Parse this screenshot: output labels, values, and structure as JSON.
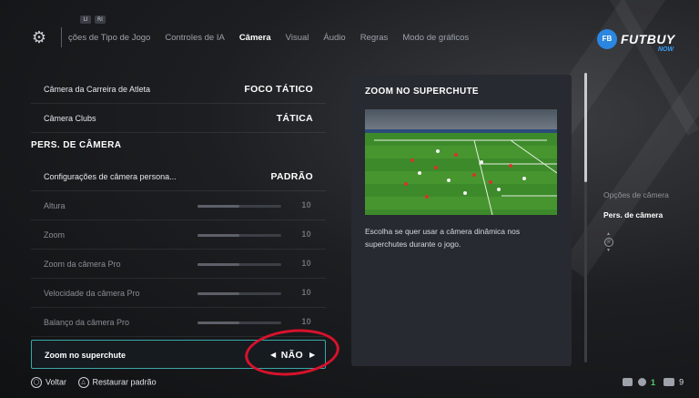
{
  "nav": {
    "bumper_left": "LI",
    "bumper_right": "RI",
    "tabs": [
      {
        "label": "ções de Tipo de Jogo"
      },
      {
        "label": "Controles de IA"
      },
      {
        "label": "Câmera"
      },
      {
        "label": "Visual"
      },
      {
        "label": "Áudio"
      },
      {
        "label": "Regras"
      },
      {
        "label": "Modo de gráficos"
      }
    ],
    "active_tab": "Câmera"
  },
  "logo": {
    "badge": "FB",
    "name": "FUTBUY",
    "sub": "NOW"
  },
  "settings": {
    "rows": [
      {
        "label": "Câmera da Carreira de Atleta",
        "value": "FOCO TÁTICO"
      },
      {
        "label": "Câmera Clubs",
        "value": "TÁTICA"
      }
    ],
    "section_title": "PERS. DE CÂMERA",
    "custom_rows": [
      {
        "label": "Configurações de câmera persona...",
        "value": "PADRÃO"
      },
      {
        "label": "Altura",
        "value": "10",
        "level": 0.5
      },
      {
        "label": "Zoom",
        "value": "10",
        "level": 0.5
      },
      {
        "label": "Zoom da câmera Pro",
        "value": "10",
        "level": 0.5
      },
      {
        "label": "Velocidade da câmera Pro",
        "value": "10",
        "level": 0.5
      },
      {
        "label": "Balanço da câmera Pro",
        "value": "10",
        "level": 0.5
      }
    ],
    "selected": {
      "label": "Zoom no superchute",
      "value": "NÃO",
      "left_arrow": "◀",
      "right_arrow": "▶"
    }
  },
  "detail": {
    "title": "ZOOM NO SUPERCHUTE",
    "description": "Escolha se quer usar a câmera dinâmica nos superchutes durante o jogo."
  },
  "side": {
    "crumb_parent": "Opções de câmera",
    "crumb_current": "Pers. de câmera",
    "stick_label": "R"
  },
  "footer": {
    "back_glyph": "◯",
    "back_label": "Voltar",
    "reset_glyph": "△",
    "reset_label": "Restaurar padrão"
  },
  "status": {
    "count_green": "1",
    "count_users": "9"
  },
  "colors": {
    "accent_teal": "#3aa6a8",
    "annotation_red": "#d8122c",
    "logo_blue": "#2a86e0",
    "panel": "#272a30"
  }
}
